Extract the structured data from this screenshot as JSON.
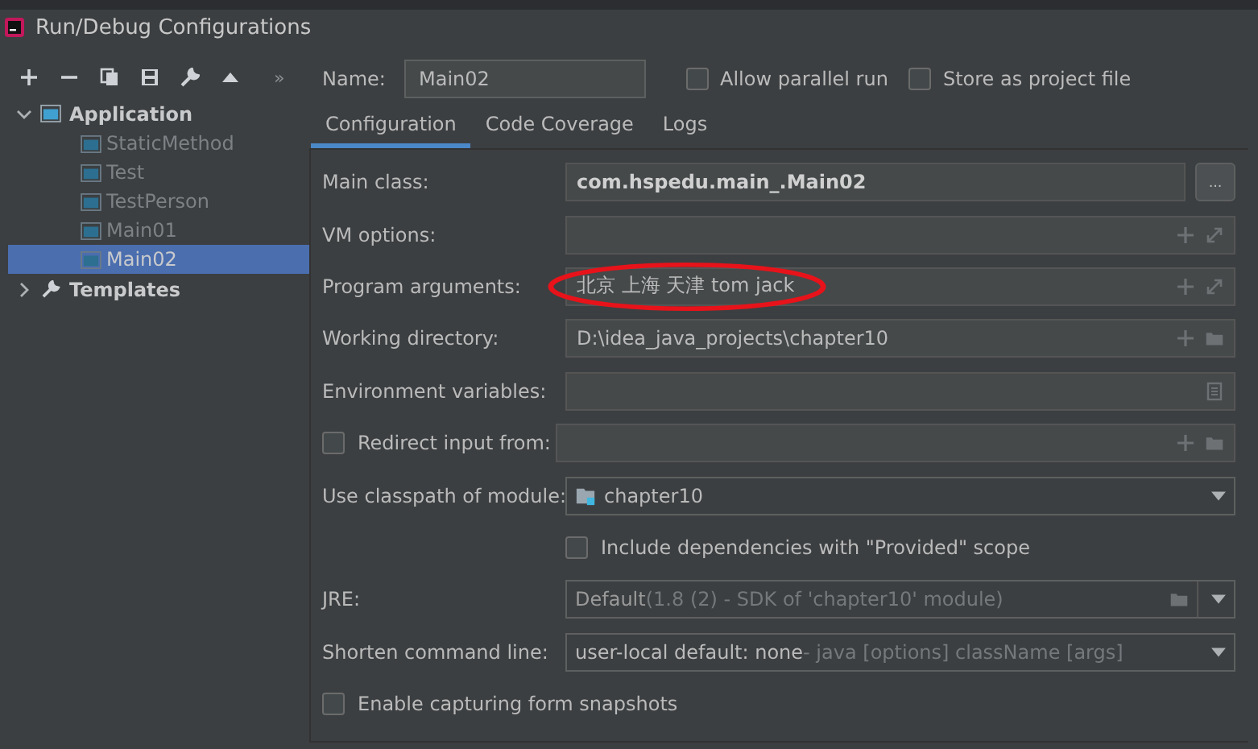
{
  "window": {
    "title": "Run/Debug Configurations"
  },
  "toolbar": {
    "overflow": "»"
  },
  "tree": [
    {
      "label": "Application",
      "expanded": true,
      "children": [
        {
          "label": "StaticMethod",
          "selected": false
        },
        {
          "label": "Test",
          "selected": false
        },
        {
          "label": "TestPerson",
          "selected": false
        },
        {
          "label": "Main01",
          "selected": false
        },
        {
          "label": "Main02",
          "selected": true
        }
      ]
    },
    {
      "label": "Templates",
      "expanded": false
    }
  ],
  "name": {
    "label": "Name:",
    "value": "Main02"
  },
  "options": [
    {
      "label": "Allow parallel run",
      "checked": false
    },
    {
      "label": "Store as project file",
      "checked": false
    }
  ],
  "tabs": [
    {
      "label": "Configuration",
      "selected": true
    },
    {
      "label": "Code Coverage",
      "selected": false
    },
    {
      "label": "Logs",
      "selected": false
    }
  ],
  "rows": [
    {
      "kind": "class",
      "label": "Main class:",
      "value": "com.hspedu.main_.Main02",
      "browse": "..."
    },
    {
      "kind": "text",
      "label": "VM options:"
    },
    {
      "kind": "text",
      "label": "Program arguments:",
      "value": "北京 上海 天津 tom jack",
      "circled": true
    },
    {
      "kind": "path",
      "label": "Working directory:",
      "value": "D:\\idea_java_projects\\chapter10"
    },
    {
      "kind": "env",
      "label": "Environment variables:"
    },
    {
      "kind": "check-path",
      "label": "Redirect input from:",
      "checked": false
    },
    {
      "kind": "module",
      "label": "Use classpath of module:",
      "value": "chapter10"
    },
    {
      "kind": "sub-check",
      "label": "Include dependencies with \"Provided\" scope",
      "checked": false
    },
    {
      "kind": "jre",
      "label": "JRE:",
      "value": "Default",
      "hint": "(1.8 (2) - SDK of 'chapter10' module)",
      "disabled": true
    },
    {
      "kind": "select",
      "label": "Shorten command line:",
      "value": "user-local default: none",
      "hint": "- java [options] className [args]"
    },
    {
      "kind": "check",
      "label": "Enable capturing form snapshots",
      "checked": false
    }
  ]
}
